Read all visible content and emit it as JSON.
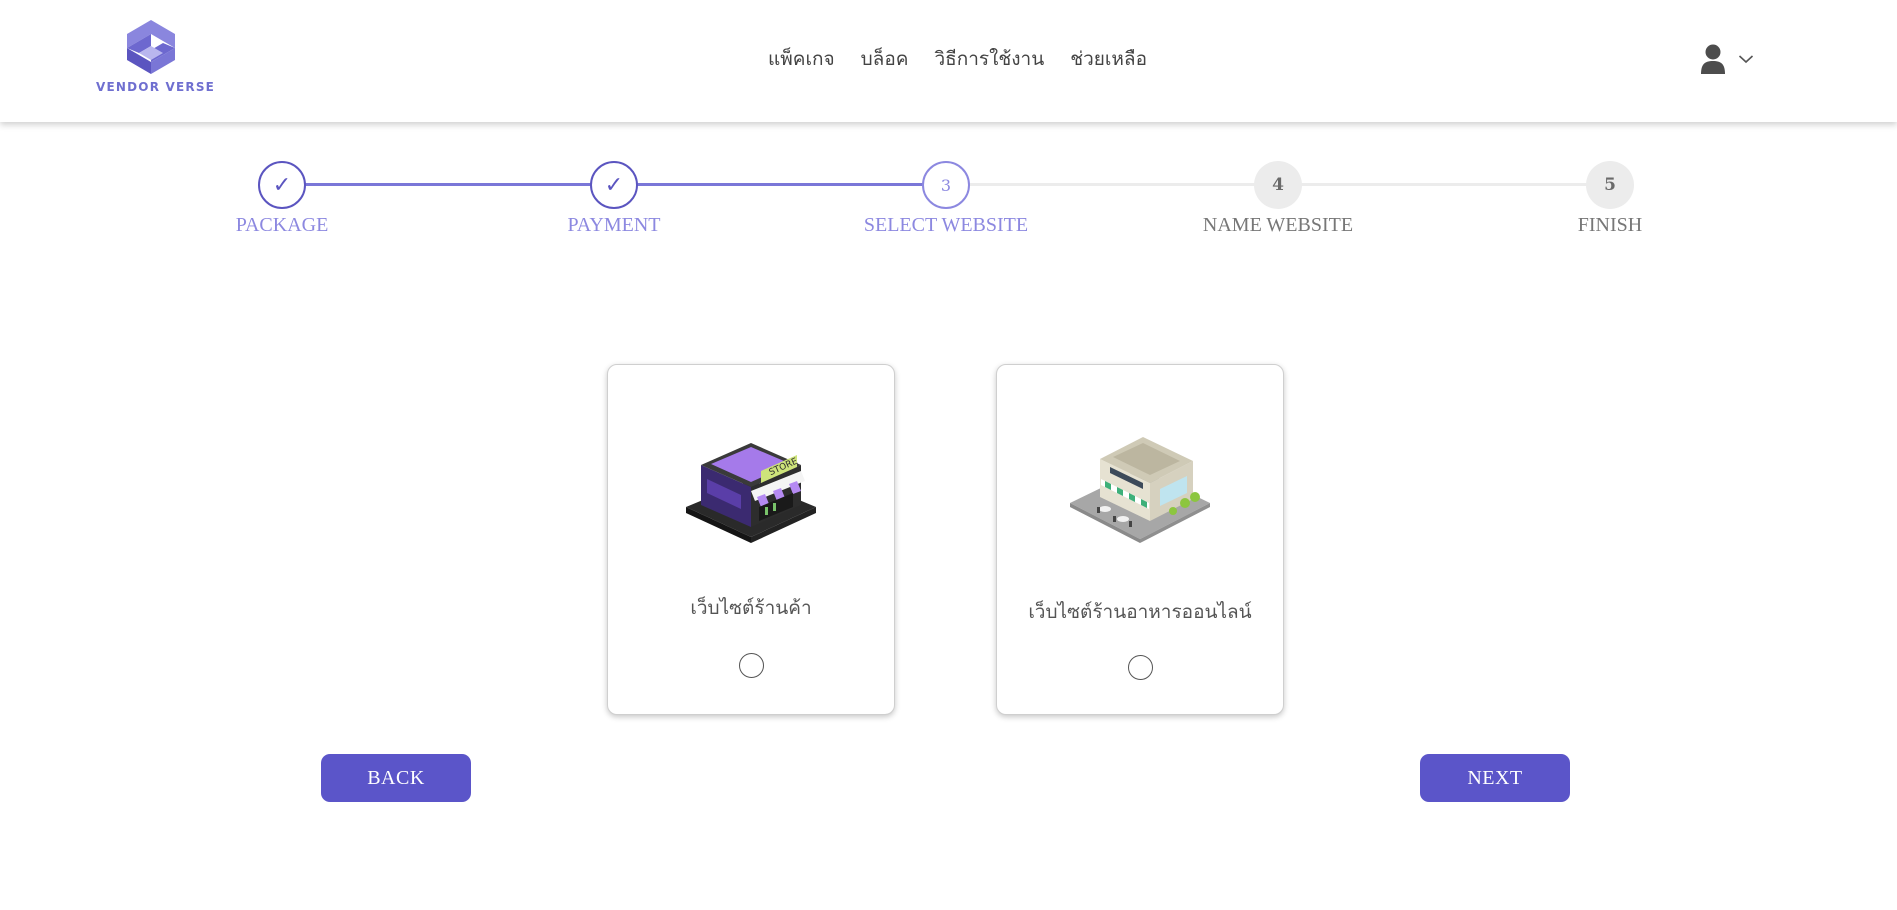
{
  "brand": {
    "name": "VENDOR VERSE",
    "color": "#6f6fd0"
  },
  "nav": {
    "items": [
      {
        "label": "แพ็คเกจ"
      },
      {
        "label": "บล็อค"
      },
      {
        "label": "วิธีการใช้งาน"
      },
      {
        "label": "ช่วยเหลือ"
      }
    ]
  },
  "user_menu": {
    "icon": "user-icon",
    "dropdown_icon": "chevron-down-icon"
  },
  "stepper": {
    "accent_color": "#5b55c0",
    "steps": [
      {
        "label": "PACKAGE",
        "state": "done",
        "marker": "✓"
      },
      {
        "label": "PAYMENT",
        "state": "done",
        "marker": "✓"
      },
      {
        "label": "SELECT WEBSITE",
        "state": "active",
        "marker": "3"
      },
      {
        "label": "NAME WEBSITE",
        "state": "pending",
        "marker": "4"
      },
      {
        "label": "FINISH",
        "state": "pending",
        "marker": "5"
      }
    ]
  },
  "options": [
    {
      "title": "เว็บไซต์ร้านค้า",
      "image": "store-building-icon",
      "selected": false
    },
    {
      "title": "เว็บไซต์ร้านอาหารออนไลน์",
      "image": "restaurant-building-icon",
      "selected": false
    }
  ],
  "buttons": {
    "back": "BACK",
    "next": "NEXT",
    "color": "#5b55c9"
  }
}
